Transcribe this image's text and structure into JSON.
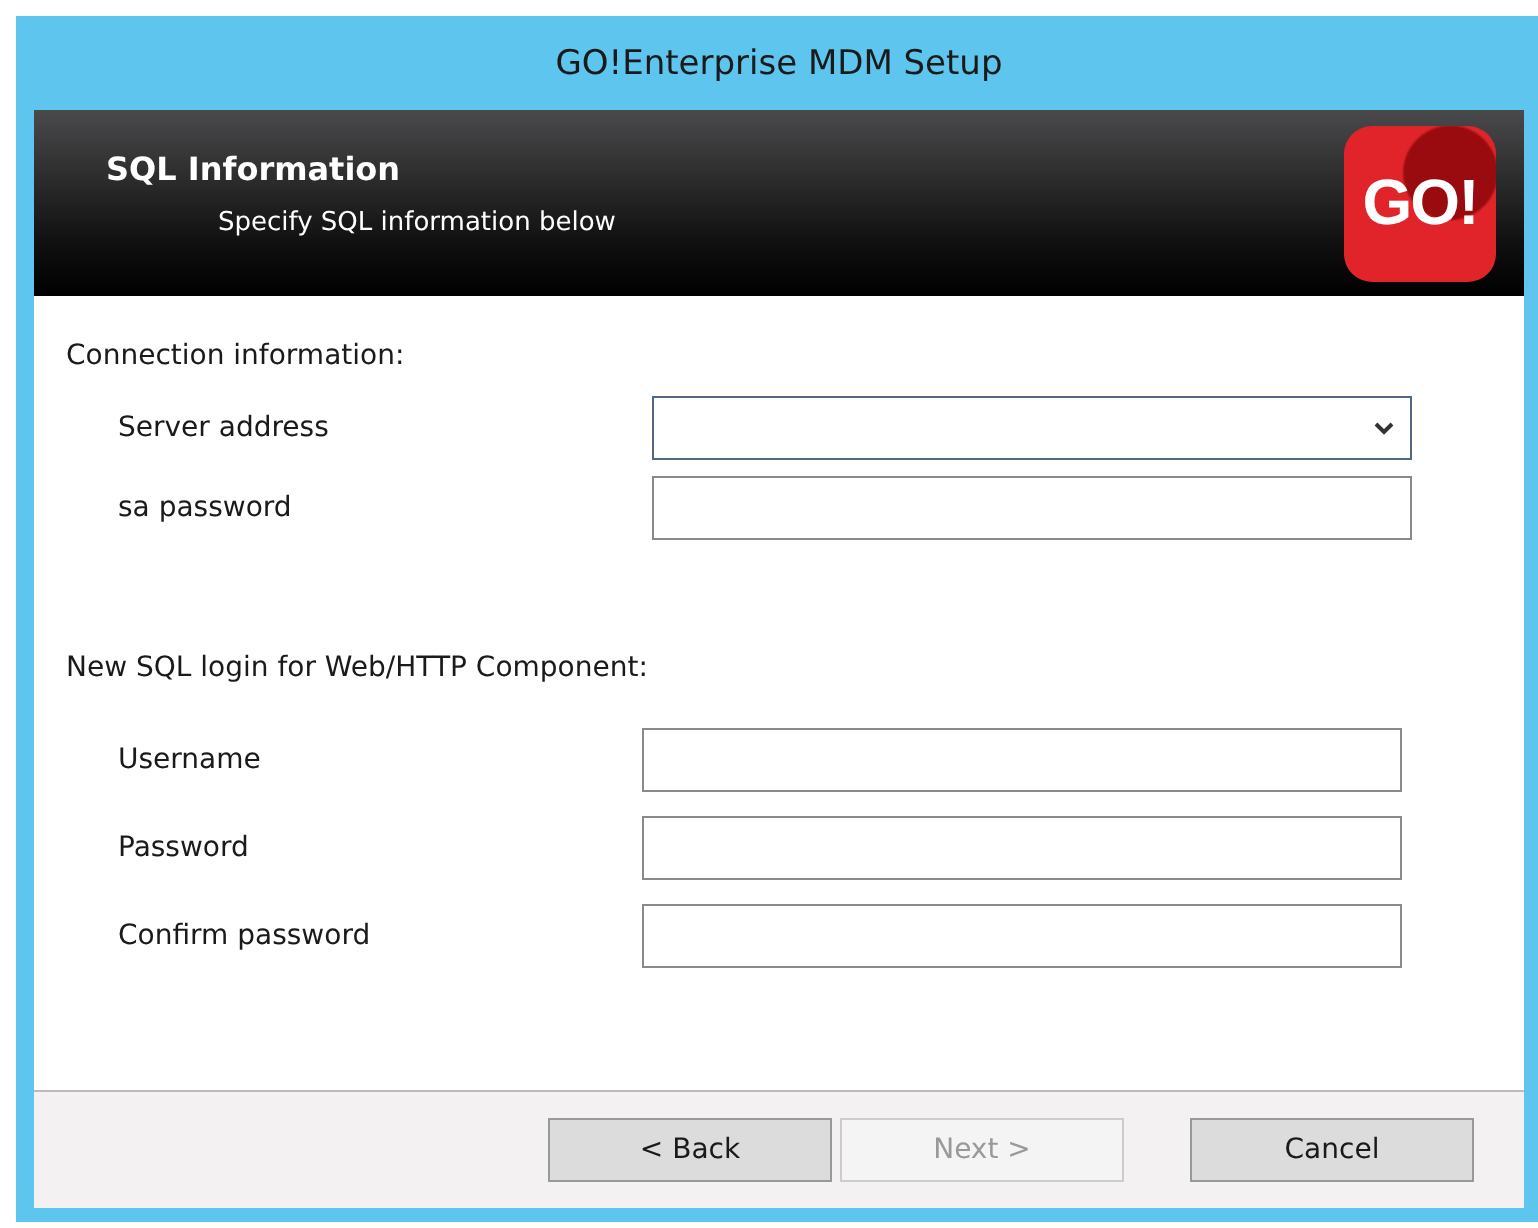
{
  "window": {
    "title": "GO!Enterprise MDM Setup"
  },
  "header": {
    "title": "SQL Information",
    "subtitle": "Specify SQL information below",
    "logo": "GO!"
  },
  "sections": [
    {
      "title": "Connection information:",
      "fields": [
        {
          "label": "Server address",
          "kind": "dropdown"
        },
        {
          "label": "sa password",
          "kind": "text"
        }
      ]
    },
    {
      "title": "New SQL login for Web/HTTP Component:",
      "fields": [
        {
          "label": "Username",
          "kind": "text"
        },
        {
          "label": "Password",
          "kind": "text"
        },
        {
          "label": "Confirm password",
          "kind": "text"
        }
      ]
    }
  ],
  "buttons": [
    {
      "label": "< Back",
      "disabled": false
    },
    {
      "label": "Next >",
      "disabled": true
    },
    {
      "label": "Cancel",
      "disabled": false
    }
  ]
}
